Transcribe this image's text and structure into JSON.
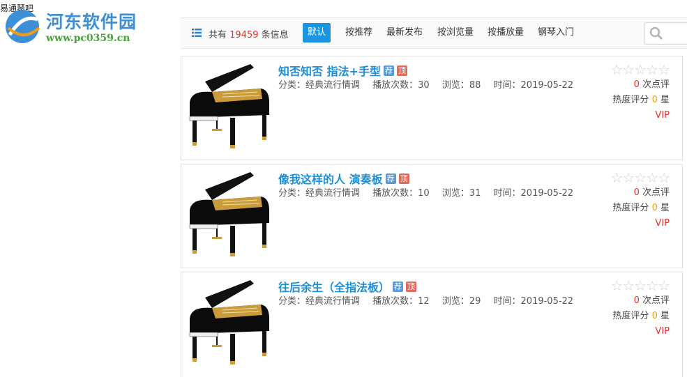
{
  "window": {
    "title": "易通琴吧"
  },
  "watermark": {
    "name": "河东软件园",
    "url": "www.pc0359.cn"
  },
  "toolbar": {
    "count_prefix": "共有",
    "count_value": "19459",
    "count_suffix": "条信息",
    "sort_options": [
      "默认",
      "按推荐",
      "最新发布",
      "按浏览量",
      "按播放量",
      "钢琴入门"
    ],
    "active_sort": "默认"
  },
  "items": [
    {
      "title": "知否知否 指法+手型",
      "badge_recommend": "荐",
      "badge_top": "顶",
      "category": "分类：经典流行情调",
      "plays": "播放次数：30",
      "views": "浏览：88",
      "time": "时间：2019-05-22",
      "stars": "☆☆☆☆☆",
      "review_count": "0",
      "review_label": "次点评",
      "heat_label": "热度评分",
      "heat_value": "0",
      "heat_unit": "星",
      "vip": "VIP"
    },
    {
      "title": "像我这样的人 演奏板",
      "badge_recommend": "荐",
      "badge_top": "顶",
      "category": "分类：经典流行情调",
      "plays": "播放次数：10",
      "views": "浏览：31",
      "time": "时间：2019-05-22",
      "stars": "☆☆☆☆☆",
      "review_count": "0",
      "review_label": "次点评",
      "heat_label": "热度评分",
      "heat_value": "0",
      "heat_unit": "星",
      "vip": "VIP"
    },
    {
      "title": "往后余生（全指法板）",
      "badge_recommend": "荐",
      "badge_top": "顶",
      "category": "分类：经典流行情调",
      "plays": "播放次数：12",
      "views": "浏览：29",
      "time": "时间：2019-05-22",
      "stars": "☆☆☆☆☆",
      "review_count": "0",
      "review_label": "次点评",
      "heat_label": "热度评分",
      "heat_value": "0",
      "heat_unit": "星",
      "vip": "VIP"
    }
  ],
  "colors": {
    "accent": "#1b95e0",
    "title": "#1e8fd7",
    "red": "#e0322a",
    "orange": "#f39c12"
  }
}
